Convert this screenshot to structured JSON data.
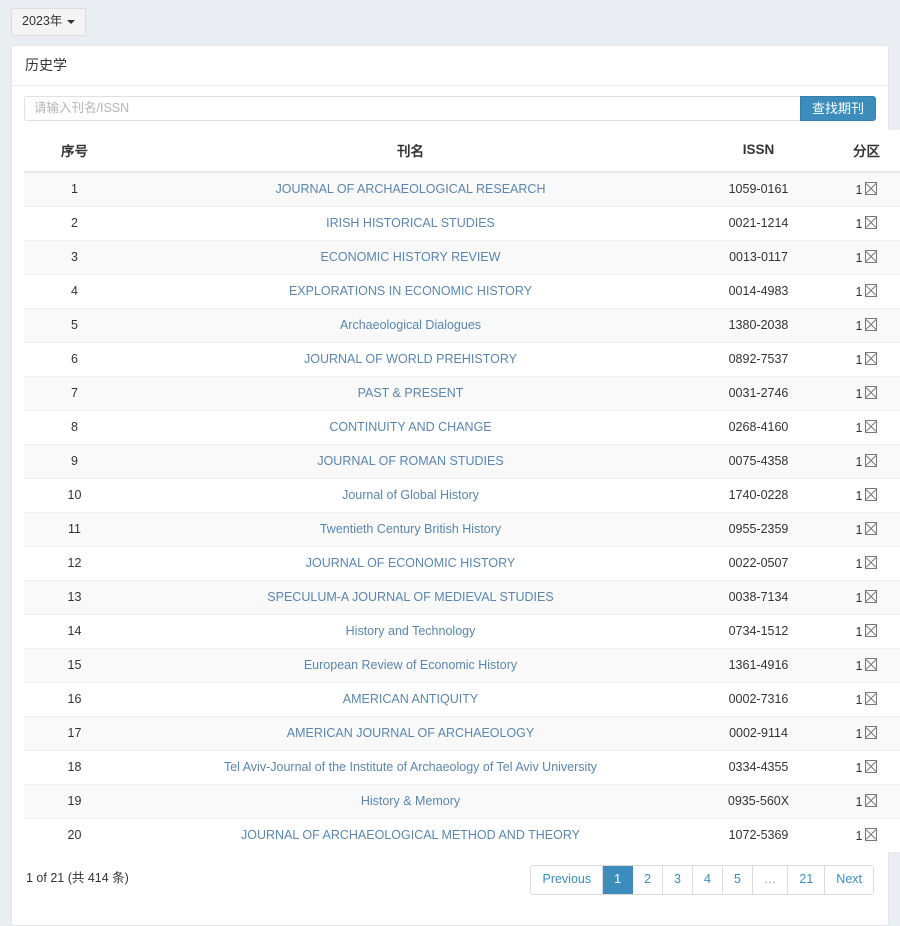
{
  "year_selector": {
    "label": "2023年",
    "caret_icon": "chevron-down-icon"
  },
  "panel": {
    "title": "历史学"
  },
  "search": {
    "placeholder": "请输入刊名/ISSN",
    "value": "",
    "button_label": "查找期刊"
  },
  "table": {
    "headers": {
      "seq": "序号",
      "title": "刊名",
      "issn": "ISSN",
      "zone": "分区"
    },
    "rows": [
      {
        "seq": "1",
        "title": "JOURNAL OF ARCHAEOLOGICAL RESEARCH",
        "issn": "1059-0161",
        "zone": "1 区"
      },
      {
        "seq": "2",
        "title": "IRISH HISTORICAL STUDIES",
        "issn": "0021-1214",
        "zone": "1 区"
      },
      {
        "seq": "3",
        "title": "ECONOMIC HISTORY REVIEW",
        "issn": "0013-0117",
        "zone": "1 区"
      },
      {
        "seq": "4",
        "title": "EXPLORATIONS IN ECONOMIC HISTORY",
        "issn": "0014-4983",
        "zone": "1 区"
      },
      {
        "seq": "5",
        "title": "Archaeological Dialogues",
        "issn": "1380-2038",
        "zone": "1 区"
      },
      {
        "seq": "6",
        "title": "JOURNAL OF WORLD PREHISTORY",
        "issn": "0892-7537",
        "zone": "1 区"
      },
      {
        "seq": "7",
        "title": "PAST & PRESENT",
        "issn": "0031-2746",
        "zone": "1 区"
      },
      {
        "seq": "8",
        "title": "CONTINUITY AND CHANGE",
        "issn": "0268-4160",
        "zone": "1 区"
      },
      {
        "seq": "9",
        "title": "JOURNAL OF ROMAN STUDIES",
        "issn": "0075-4358",
        "zone": "1 区"
      },
      {
        "seq": "10",
        "title": "Journal of Global History",
        "issn": "1740-0228",
        "zone": "1 区"
      },
      {
        "seq": "11",
        "title": "Twentieth Century British History",
        "issn": "0955-2359",
        "zone": "1 区"
      },
      {
        "seq": "12",
        "title": "JOURNAL OF ECONOMIC HISTORY",
        "issn": "0022-0507",
        "zone": "1 区"
      },
      {
        "seq": "13",
        "title": "SPECULUM-A JOURNAL OF MEDIEVAL STUDIES",
        "issn": "0038-7134",
        "zone": "1 区"
      },
      {
        "seq": "14",
        "title": "History and Technology",
        "issn": "0734-1512",
        "zone": "1 区"
      },
      {
        "seq": "15",
        "title": "European Review of Economic History",
        "issn": "1361-4916",
        "zone": "1 区"
      },
      {
        "seq": "16",
        "title": "AMERICAN ANTIQUITY",
        "issn": "0002-7316",
        "zone": "1 区"
      },
      {
        "seq": "17",
        "title": "AMERICAN JOURNAL OF ARCHAEOLOGY",
        "issn": "0002-9114",
        "zone": "1 区"
      },
      {
        "seq": "18",
        "title": "Tel Aviv-Journal of the Institute of Archaeology of Tel Aviv University",
        "issn": "0334-4355",
        "zone": "1 区"
      },
      {
        "seq": "19",
        "title": "History & Memory",
        "issn": "0935-560X",
        "zone": "1 区"
      },
      {
        "seq": "20",
        "title": "JOURNAL OF ARCHAEOLOGICAL METHOD AND THEORY",
        "issn": "1072-5369",
        "zone": "1 区"
      }
    ]
  },
  "footer": {
    "record_info": "1 of 21 (共 414 条)",
    "pagination": {
      "previous_label": "Previous",
      "next_label": "Next",
      "pages": [
        "1",
        "2",
        "3",
        "4",
        "5",
        "…",
        "21"
      ],
      "active_page": "1"
    }
  },
  "colors": {
    "page_background": "#eaedf1",
    "accent_blue": "#3c8dbc",
    "link_blue": "#5b86ad",
    "row_stripe": "#f9f9fa"
  }
}
